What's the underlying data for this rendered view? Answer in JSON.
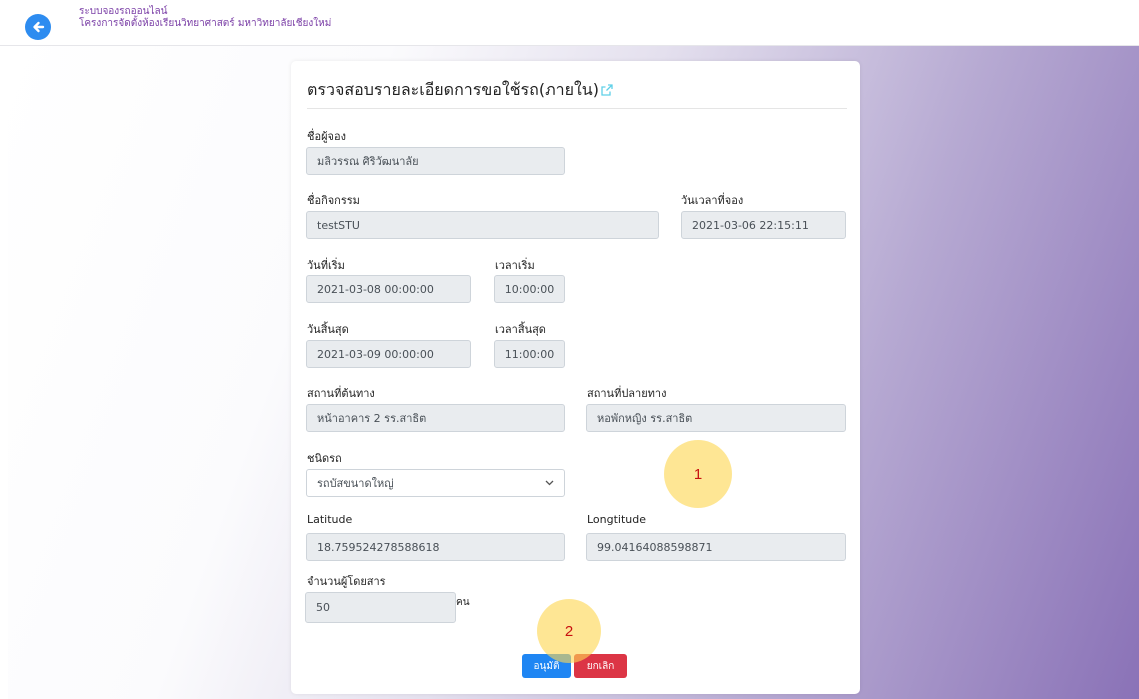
{
  "header": {
    "brand_line1": "ระบบจองรถออนไลน์",
    "brand_line2": "โครงการจัดตั้งห้องเรียนวิทยาศาสตร์ มหาวิทยาลัยเชียงใหม่"
  },
  "card": {
    "title": "ตรวจสอบรายละเอียดการขอใช้รถ(ภายใน)",
    "fields": {
      "booker_label": "ชื่อผู้จอง",
      "booker_value": "มลิวรรณ ศิริวัฒนาลัย",
      "activity_label": "ชื่อกิจกรรม",
      "activity_value": "testSTU",
      "booked_at_label": "วันเวลาที่จอง",
      "booked_at_value": "2021-03-06 22:15:11",
      "start_date_label": "วันที่เริ่ม",
      "start_date_value": "2021-03-08 00:00:00",
      "start_time_label": "เวลาเริ่ม",
      "start_time_value": "10:00:00",
      "end_date_label": "วันสิ้นสุด",
      "end_date_value": "2021-03-09 00:00:00",
      "end_time_label": "เวลาสิ้นสุด",
      "end_time_value": "11:00:00",
      "origin_label": "สถานที่ต้นทาง",
      "origin_value": "หน้าอาคาร 2 รร.สาธิต",
      "destination_label": "สถานที่ปลายทาง",
      "destination_value": "หอพักหญิง รร.สาธิต",
      "vehicle_label": "ชนิดรถ",
      "vehicle_value": "รถบัสขนาดใหญ่",
      "latitude_label": "Latitude",
      "latitude_value": "18.759524278588618",
      "longitude_label": "Longtitude",
      "longitude_value": "99.04164088598871",
      "passengers_label": "จำนวนผู้โดยสาร",
      "passengers_value": "50",
      "passengers_unit": "คน"
    },
    "buttons": {
      "approve": "อนุมัติ",
      "cancel": "ยกเลิก"
    }
  },
  "markers": {
    "m1": "1",
    "m2": "2"
  },
  "colors": {
    "accent": "#1f86f3",
    "danger": "#dc3545",
    "brand_text": "#7a3ea6",
    "marker": "#fdd653"
  },
  "icons": {
    "back": "arrow-left-circle-icon",
    "external": "external-link-icon",
    "chevron": "chevron-down-icon"
  }
}
